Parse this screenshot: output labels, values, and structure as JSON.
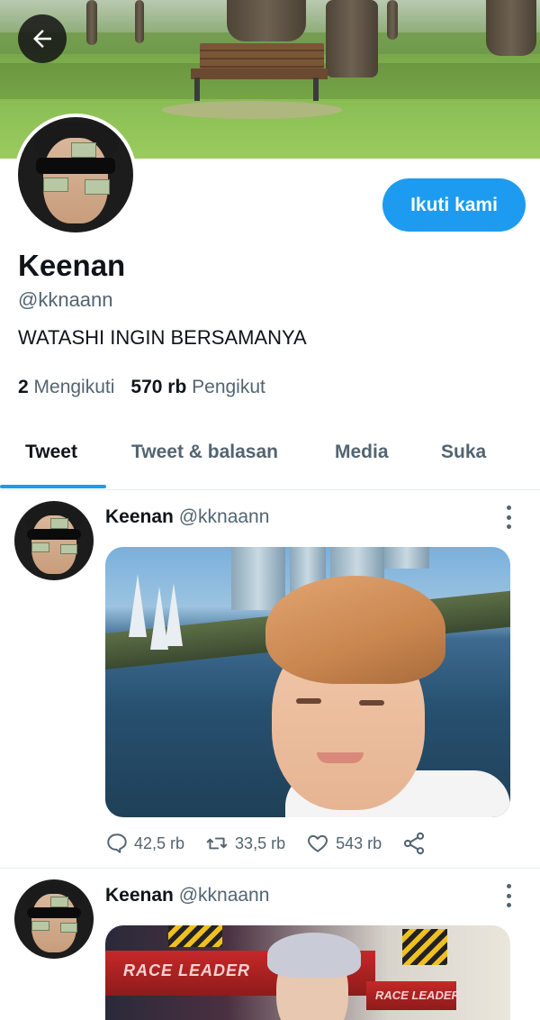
{
  "header": {
    "back_label": "back"
  },
  "profile": {
    "name": "Keenan",
    "handle": "@kknaann",
    "bio": "WATASHI INGIN BERSAMANYA",
    "follow_label": "Ikuti kami",
    "following_count": "2",
    "following_label": "Mengikuti",
    "followers_count": "570 rb",
    "followers_label": "Pengikut"
  },
  "tabs": [
    {
      "label": "Tweet",
      "active": true
    },
    {
      "label": "Tweet & balasan",
      "active": false
    },
    {
      "label": "Media",
      "active": false
    },
    {
      "label": "Suka",
      "active": false
    }
  ],
  "tweets": [
    {
      "author": "Keenan",
      "handle": "@kknaann",
      "replies": "42,5 rb",
      "retweets": "33,5 rb",
      "likes": "543 rb"
    },
    {
      "author": "Keenan",
      "handle": "@kknaann",
      "banner_text_1": "RACE LEADER",
      "banner_text_2": "RACE LEADER"
    }
  ],
  "colors": {
    "accent": "#1d9bf0",
    "muted": "#536471",
    "text": "#0f1419"
  }
}
